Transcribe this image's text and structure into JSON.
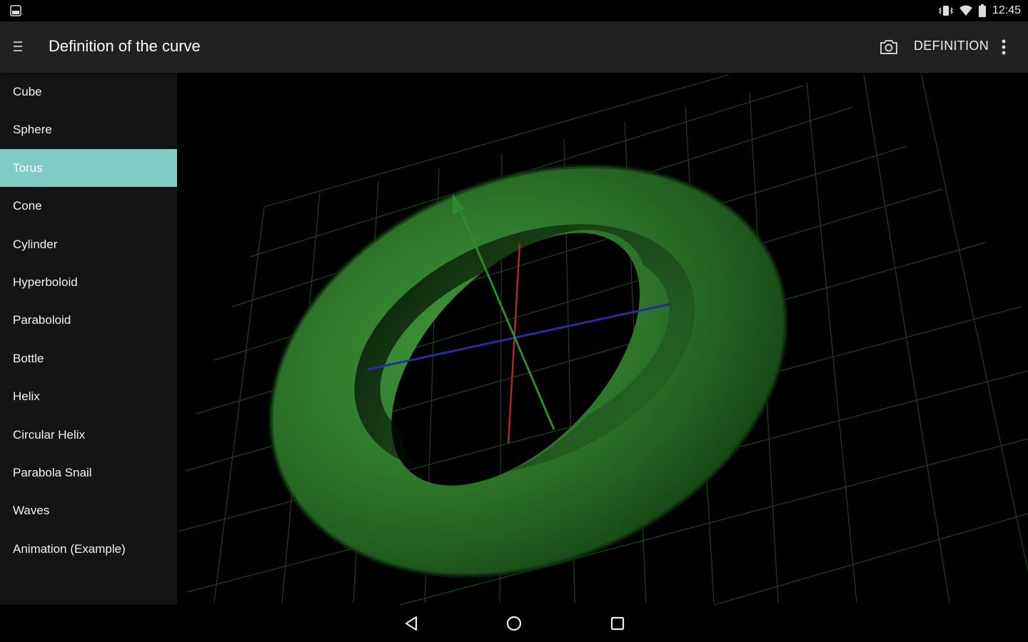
{
  "status_bar": {
    "time": "12:45",
    "icons": [
      "notification-icon",
      "vibrate-icon",
      "wifi-icon",
      "battery-icon"
    ]
  },
  "app_bar": {
    "title": "Definition of the curve",
    "definition_label": "DEFINITION",
    "icons": [
      "menu-icon",
      "camera-icon",
      "more-vert-icon"
    ]
  },
  "drawer": {
    "items": [
      {
        "label": "Cube"
      },
      {
        "label": "Sphere"
      },
      {
        "label": "Torus",
        "selected": true
      },
      {
        "label": "Cone"
      },
      {
        "label": "Cylinder"
      },
      {
        "label": "Hyperboloid"
      },
      {
        "label": "Paraboloid"
      },
      {
        "label": "Bottle"
      },
      {
        "label": "Helix"
      },
      {
        "label": "Circular Helix"
      },
      {
        "label": "Parabola Snail"
      },
      {
        "label": "Waves"
      },
      {
        "label": "Animation (Example)"
      }
    ]
  },
  "scene": {
    "shape": "torus",
    "colors": {
      "torus": "#2f7a2a",
      "grid": "#1f4a1f",
      "axis_x": "#2b2b9e",
      "axis_y": "#2f8a2f",
      "axis_z": "#a32b2b"
    }
  },
  "colors": {
    "app_bar": "#212121",
    "drawer_bg": "#141414",
    "selected": "#80cbc4"
  },
  "nav_bar": {
    "icons": [
      "back-icon",
      "home-icon",
      "recents-icon"
    ]
  }
}
